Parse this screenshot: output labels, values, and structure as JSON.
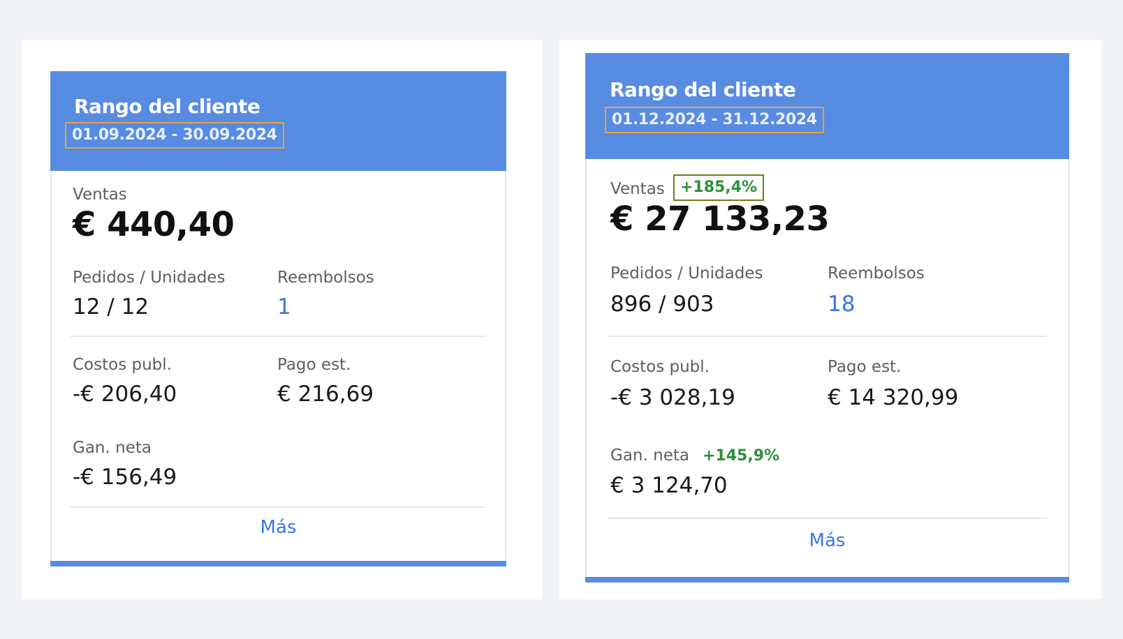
{
  "cards": [
    {
      "title": "Rango del cliente",
      "date_range": "01.09.2024 - 30.09.2024",
      "sales_label": "Ventas",
      "sales_value": "€ 440,40",
      "orders_label": "Pedidos / Unidades",
      "orders_value": "12 / 12",
      "refunds_label": "Reembolsos",
      "refunds_value": "1",
      "ad_costs_label": "Costos publ.",
      "ad_costs_value": "-€ 206,40",
      "payout_label": "Pago est.",
      "payout_value": "€ 216,69",
      "net_label": "Gan. neta",
      "net_value": "-€ 156,49",
      "more_label": "Más"
    },
    {
      "title": "Rango del cliente",
      "date_range": "01.12.2024 - 31.12.2024",
      "sales_label": "Ventas",
      "sales_change": "+185,4%",
      "sales_value": "€ 27 133,23",
      "orders_label": "Pedidos / Unidades",
      "orders_value": "896 / 903",
      "refunds_label": "Reembolsos",
      "refunds_value": "18",
      "ad_costs_label": "Costos publ.",
      "ad_costs_value": "-€ 3 028,19",
      "payout_label": "Pago est.",
      "payout_value": "€ 14 320,99",
      "net_label": "Gan. neta",
      "net_change": "+145,9%",
      "net_value": "€ 3 124,70",
      "more_label": "Más"
    }
  ],
  "colors": {
    "header_bg": "#578ce2",
    "highlight_border": "#e8a33a",
    "positive": "#2f8f3d",
    "link": "#3a77e0"
  }
}
